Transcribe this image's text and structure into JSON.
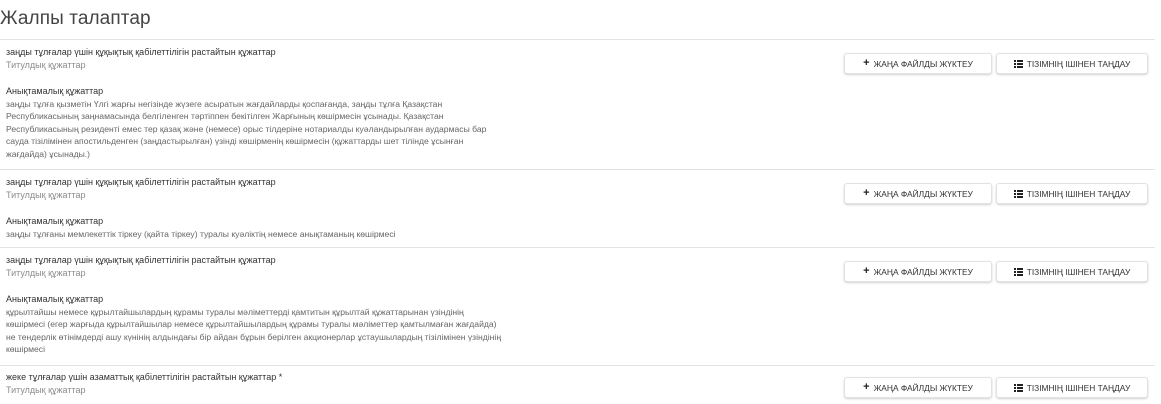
{
  "page": {
    "title": "Жалпы талаптар"
  },
  "buttons": {
    "upload_label": "ЖАҢА ФАЙЛДЫ ЖҮКТЕУ",
    "choose_label": "ТІЗІМНІҢ ІШІНЕН ТАҢДАУ",
    "upload_icon": "plus-icon",
    "choose_icon": "list-icon"
  },
  "sections": [
    {
      "title": "заңды тұлғалар үшін құқықтық қабілеттілігін растайтын құжаттар",
      "subtitle": "Титулдық құжаттар",
      "desc_label": "Анықтамалық құжаттар",
      "desc_lines": [
        "заңды тұлға қызметін Үлгі жарғы негізінде жүзеге асыратын жағдайларды қоспағанда, заңды тұлға Қазақстан",
        "Республикасының заңнамасында белгіленген тәртіппен бекітілген Жарғының көшірмесін ұсынады. Қазақстан",
        "Республикасының резиденті емес тер қазақ және (немесе) орыс тілдеріне нотариалды куәландырылған аудармасы бар",
        "сауда тізілімінен апостильденген (заңдастырылған) үзінді көшірменің көшірмесін (құжаттарды шет тілінде ұсынған",
        "жағдайда) ұсынады.)"
      ]
    },
    {
      "title": "заңды тұлғалар үшін құқықтық қабілеттілігін растайтын құжаттар",
      "subtitle": "Титулдық құжаттар",
      "desc_label": "Анықтамалық құжаттар",
      "desc_lines": [
        "заңды тұлғаны мемлекеттік тіркеу (қайта тіркеу) туралы куәліктің немесе анықтаманың көшірмесі"
      ]
    },
    {
      "title": "заңды тұлғалар үшін құқықтық қабілеттілігін растайтын құжаттар",
      "subtitle": "Титулдық құжаттар",
      "desc_label": "Анықтамалық құжаттар",
      "desc_lines": [
        "құрылтайшы немесе құрылтайшылардың құрамы туралы мәліметтерді қамтитын құрылтай құжаттарынан үзіндінің",
        "көшірмесі (егер жарғыда құрылтайшылар немесе құрылтайшылардың құрамы туралы мәліметтер қамтылмаған жағдайда)",
        "не тендерлік өтінімдерді ашу күнінің алдындағы бір айдан бұрын берілген акционерлар ұстаушылардың тізілімінен үзіндінің",
        "көшірмесі"
      ]
    },
    {
      "title": "жеке тұлғалар үшін азаматтық қабілеттілігін растайтын құжаттар *",
      "subtitle": "Титулдық құжаттар"
    }
  ]
}
